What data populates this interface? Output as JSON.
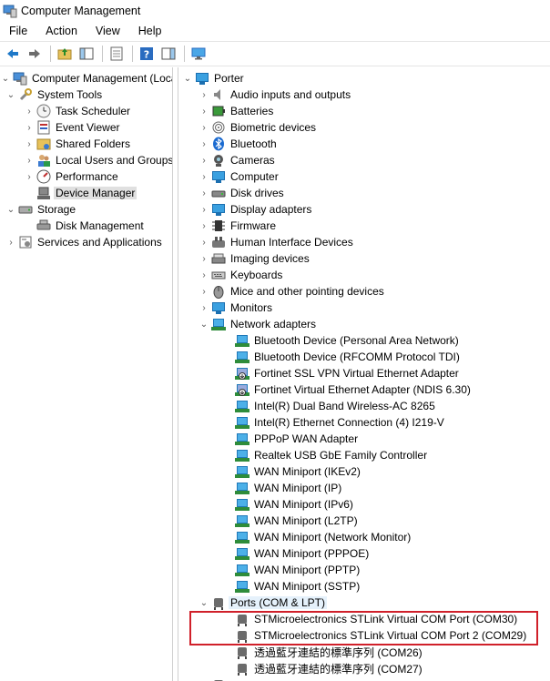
{
  "window": {
    "title": "Computer Management"
  },
  "menu": [
    "File",
    "Action",
    "View",
    "Help"
  ],
  "toolbar": [
    "back-icon",
    "forward-icon",
    "up-folder-icon",
    "show-hide-tree-icon",
    "properties-icon",
    "help-icon",
    "action-pane-icon",
    "computer-monitor-icon"
  ],
  "left_tree": [
    {
      "label": "Computer Management (Local",
      "icon": "computer-management-icon"
    },
    {
      "label": "System Tools",
      "icon": "tools-icon"
    },
    {
      "label": "Task Scheduler",
      "icon": "clock-icon"
    },
    {
      "label": "Event Viewer",
      "icon": "event-viewer-icon"
    },
    {
      "label": "Shared Folders",
      "icon": "shared-folder-icon"
    },
    {
      "label": "Local Users and Groups",
      "icon": "users-icon"
    },
    {
      "label": "Performance",
      "icon": "performance-icon"
    },
    {
      "label": "Device Manager",
      "icon": "device-manager-icon",
      "selected": true
    },
    {
      "label": "Storage",
      "icon": "storage-icon"
    },
    {
      "label": "Disk Management",
      "icon": "disk-management-icon"
    },
    {
      "label": "Services and Applications",
      "icon": "services-icon"
    }
  ],
  "device_root": "Porter",
  "categories": [
    "Audio inputs and outputs",
    "Batteries",
    "Biometric devices",
    "Bluetooth",
    "Cameras",
    "Computer",
    "Disk drives",
    "Display adapters",
    "Firmware",
    "Human Interface Devices",
    "Imaging devices",
    "Keyboards",
    "Mice and other pointing devices",
    "Monitors"
  ],
  "network_adapters": {
    "label": "Network adapters",
    "items": [
      "Bluetooth Device (Personal Area Network)",
      "Bluetooth Device (RFCOMM Protocol TDI)",
      "Fortinet SSL VPN Virtual Ethernet Adapter",
      "Fortinet Virtual Ethernet Adapter (NDIS 6.30)",
      "Intel(R) Dual Band Wireless-AC 8265",
      "Intel(R) Ethernet Connection (4) I219-V",
      "PPPoP WAN Adapter",
      "Realtek USB GbE Family Controller",
      "WAN Miniport (IKEv2)",
      "WAN Miniport (IP)",
      "WAN Miniport (IPv6)",
      "WAN Miniport (L2TP)",
      "WAN Miniport (Network Monitor)",
      "WAN Miniport (PPPOE)",
      "WAN Miniport (PPTP)",
      "WAN Miniport (SSTP)"
    ]
  },
  "ports": {
    "label": "Ports (COM & LPT)",
    "items": [
      "STMicroelectronics STLink Virtual COM Port (COM30)",
      "STMicroelectronics STLink Virtual COM Port 2 (COM29)",
      "透過藍牙連結的標準序列 (COM26)",
      "透過藍牙連結的標準序列 (COM27)"
    ]
  },
  "colors": {
    "highlight_box": "#d0202a",
    "selection": "#e0e0e0"
  }
}
